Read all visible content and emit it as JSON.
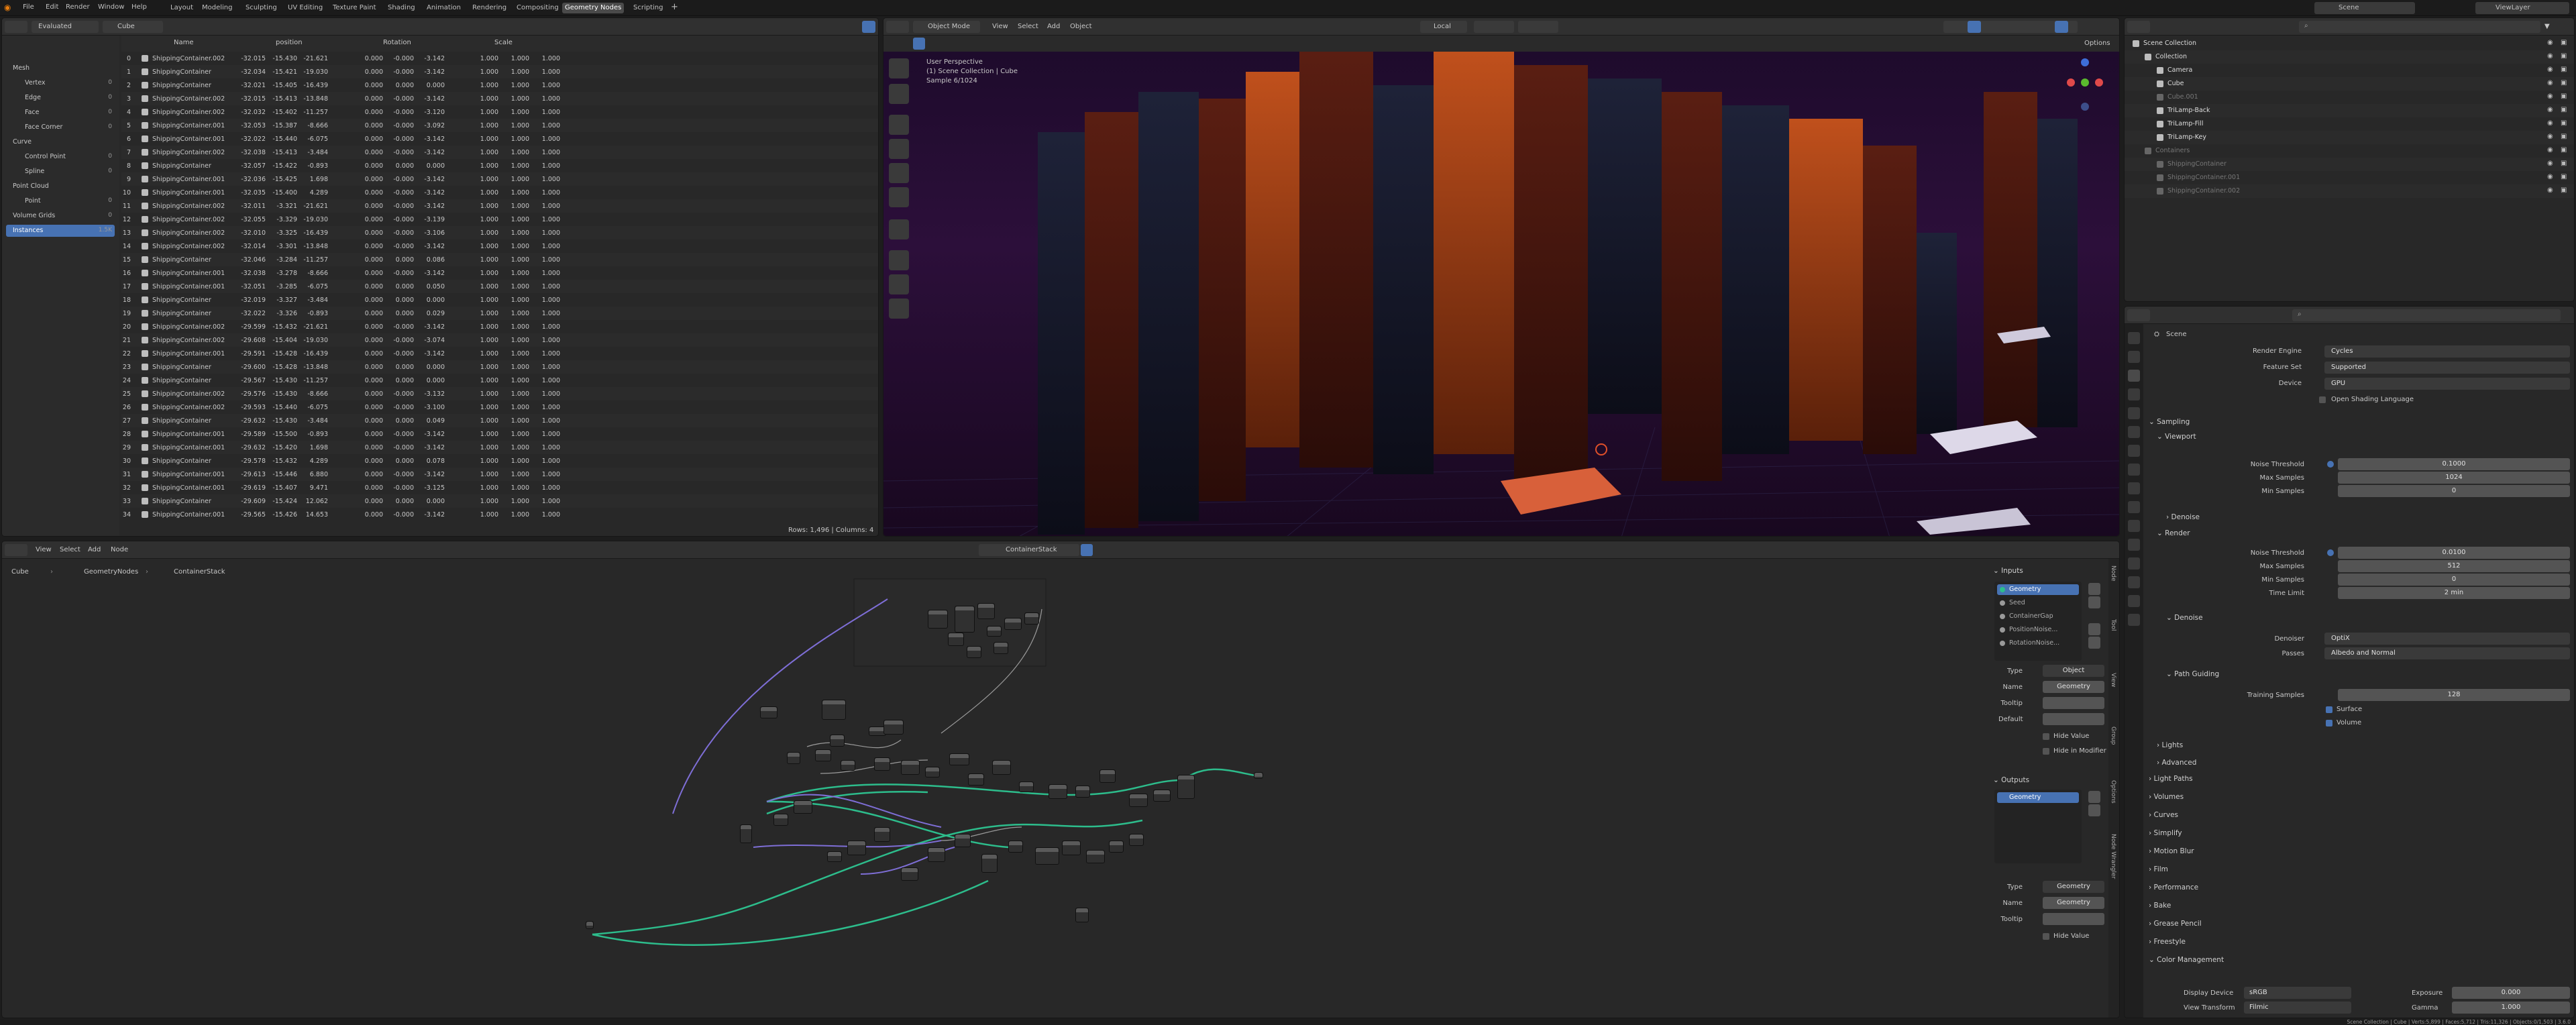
{
  "menu": {
    "file": "File",
    "edit": "Edit",
    "render": "Render",
    "window": "Window",
    "help": "Help"
  },
  "workspaces": [
    "Layout",
    "Modeling",
    "Sculpting",
    "UV Editing",
    "Texture Paint",
    "Shading",
    "Animation",
    "Rendering",
    "Compositing",
    "Geometry Nodes",
    "Scripting"
  ],
  "scene_name": "Scene",
  "view_layer": "ViewLayer",
  "spreadsheet": {
    "mode": "Evaluated",
    "object": "Cube",
    "domains": [
      {
        "label": "Mesh",
        "count": ""
      },
      {
        "label": "Vertex",
        "count": "0"
      },
      {
        "label": "Edge",
        "count": "0"
      },
      {
        "label": "Face",
        "count": "0"
      },
      {
        "label": "Face Corner",
        "count": "0"
      },
      {
        "label": "Curve",
        "count": ""
      },
      {
        "label": "Control Point",
        "count": "0"
      },
      {
        "label": "Spline",
        "count": "0"
      },
      {
        "label": "Point Cloud",
        "count": ""
      },
      {
        "label": "Point",
        "count": "0"
      },
      {
        "label": "Volume Grids",
        "count": "0"
      },
      {
        "label": "Instances",
        "count": "1.5K"
      }
    ],
    "columns": {
      "name": "Name",
      "position": "position",
      "rotation": "Rotation",
      "scale": "Scale"
    },
    "rows": [
      [
        "0",
        "ShippingContainer.002",
        "-32.015",
        "-15.430",
        "-21.621",
        "0.000",
        "-0.000",
        "-3.142",
        "1.000",
        "1.000",
        "1.000"
      ],
      [
        "1",
        "ShippingContainer",
        "-32.034",
        "-15.421",
        "-19.030",
        "0.000",
        "-0.000",
        "-3.142",
        "1.000",
        "1.000",
        "1.000"
      ],
      [
        "2",
        "ShippingContainer",
        "-32.021",
        "-15.405",
        "-16.439",
        "0.000",
        "0.000",
        "0.000",
        "1.000",
        "1.000",
        "1.000"
      ],
      [
        "3",
        "ShippingContainer.002",
        "-32.015",
        "-15.413",
        "-13.848",
        "0.000",
        "-0.000",
        "-3.142",
        "1.000",
        "1.000",
        "1.000"
      ],
      [
        "4",
        "ShippingContainer.002",
        "-32.032",
        "-15.402",
        "-11.257",
        "0.000",
        "-0.000",
        "-3.120",
        "1.000",
        "1.000",
        "1.000"
      ],
      [
        "5",
        "ShippingContainer.001",
        "-32.053",
        "-15.387",
        "-8.666",
        "0.000",
        "-0.000",
        "-3.092",
        "1.000",
        "1.000",
        "1.000"
      ],
      [
        "6",
        "ShippingContainer.001",
        "-32.022",
        "-15.440",
        "-6.075",
        "0.000",
        "-0.000",
        "-3.142",
        "1.000",
        "1.000",
        "1.000"
      ],
      [
        "7",
        "ShippingContainer.002",
        "-32.038",
        "-15.413",
        "-3.484",
        "0.000",
        "-0.000",
        "-3.142",
        "1.000",
        "1.000",
        "1.000"
      ],
      [
        "8",
        "ShippingContainer",
        "-32.057",
        "-15.422",
        "-0.893",
        "0.000",
        "0.000",
        "0.000",
        "1.000",
        "1.000",
        "1.000"
      ],
      [
        "9",
        "ShippingContainer.001",
        "-32.036",
        "-15.425",
        "1.698",
        "0.000",
        "-0.000",
        "-3.142",
        "1.000",
        "1.000",
        "1.000"
      ],
      [
        "10",
        "ShippingContainer.001",
        "-32.035",
        "-15.400",
        "4.289",
        "0.000",
        "-0.000",
        "-3.142",
        "1.000",
        "1.000",
        "1.000"
      ],
      [
        "11",
        "ShippingContainer.002",
        "-32.011",
        "-3.321",
        "-21.621",
        "0.000",
        "-0.000",
        "-3.142",
        "1.000",
        "1.000",
        "1.000"
      ],
      [
        "12",
        "ShippingContainer.002",
        "-32.055",
        "-3.329",
        "-19.030",
        "0.000",
        "-0.000",
        "-3.139",
        "1.000",
        "1.000",
        "1.000"
      ],
      [
        "13",
        "ShippingContainer.002",
        "-32.010",
        "-3.325",
        "-16.439",
        "0.000",
        "-0.000",
        "-3.106",
        "1.000",
        "1.000",
        "1.000"
      ],
      [
        "14",
        "ShippingContainer.002",
        "-32.014",
        "-3.301",
        "-13.848",
        "0.000",
        "-0.000",
        "-3.142",
        "1.000",
        "1.000",
        "1.000"
      ],
      [
        "15",
        "ShippingContainer",
        "-32.046",
        "-3.284",
        "-11.257",
        "0.000",
        "0.000",
        "0.086",
        "1.000",
        "1.000",
        "1.000"
      ],
      [
        "16",
        "ShippingContainer.001",
        "-32.038",
        "-3.278",
        "-8.666",
        "0.000",
        "-0.000",
        "-3.142",
        "1.000",
        "1.000",
        "1.000"
      ],
      [
        "17",
        "ShippingContainer.001",
        "-32.051",
        "-3.285",
        "-6.075",
        "0.000",
        "0.000",
        "0.050",
        "1.000",
        "1.000",
        "1.000"
      ],
      [
        "18",
        "ShippingContainer",
        "-32.019",
        "-3.327",
        "-3.484",
        "0.000",
        "0.000",
        "0.000",
        "1.000",
        "1.000",
        "1.000"
      ],
      [
        "19",
        "ShippingContainer",
        "-32.022",
        "-3.326",
        "-0.893",
        "0.000",
        "0.000",
        "0.029",
        "1.000",
        "1.000",
        "1.000"
      ],
      [
        "20",
        "ShippingContainer.002",
        "-29.599",
        "-15.432",
        "-21.621",
        "0.000",
        "-0.000",
        "-3.142",
        "1.000",
        "1.000",
        "1.000"
      ],
      [
        "21",
        "ShippingContainer.002",
        "-29.608",
        "-15.404",
        "-19.030",
        "0.000",
        "-0.000",
        "-3.074",
        "1.000",
        "1.000",
        "1.000"
      ],
      [
        "22",
        "ShippingContainer.001",
        "-29.591",
        "-15.428",
        "-16.439",
        "0.000",
        "-0.000",
        "-3.142",
        "1.000",
        "1.000",
        "1.000"
      ],
      [
        "23",
        "ShippingContainer",
        "-29.600",
        "-15.428",
        "-13.848",
        "0.000",
        "0.000",
        "0.000",
        "1.000",
        "1.000",
        "1.000"
      ],
      [
        "24",
        "ShippingContainer",
        "-29.567",
        "-15.430",
        "-11.257",
        "0.000",
        "0.000",
        "0.000",
        "1.000",
        "1.000",
        "1.000"
      ],
      [
        "25",
        "ShippingContainer.002",
        "-29.576",
        "-15.430",
        "-8.666",
        "0.000",
        "-0.000",
        "-3.132",
        "1.000",
        "1.000",
        "1.000"
      ],
      [
        "26",
        "ShippingContainer.002",
        "-29.593",
        "-15.440",
        "-6.075",
        "0.000",
        "-0.000",
        "-3.100",
        "1.000",
        "1.000",
        "1.000"
      ],
      [
        "27",
        "ShippingContainer",
        "-29.632",
        "-15.430",
        "-3.484",
        "0.000",
        "0.000",
        "0.049",
        "1.000",
        "1.000",
        "1.000"
      ],
      [
        "28",
        "ShippingContainer.001",
        "-29.589",
        "-15.500",
        "-0.893",
        "0.000",
        "-0.000",
        "-3.142",
        "1.000",
        "1.000",
        "1.000"
      ],
      [
        "29",
        "ShippingContainer.001",
        "-29.632",
        "-15.420",
        "1.698",
        "0.000",
        "-0.000",
        "-3.142",
        "1.000",
        "1.000",
        "1.000"
      ],
      [
        "30",
        "ShippingContainer",
        "-29.578",
        "-15.432",
        "4.289",
        "0.000",
        "0.000",
        "0.078",
        "1.000",
        "1.000",
        "1.000"
      ],
      [
        "31",
        "ShippingContainer.001",
        "-29.613",
        "-15.446",
        "6.880",
        "0.000",
        "-0.000",
        "-3.142",
        "1.000",
        "1.000",
        "1.000"
      ],
      [
        "32",
        "ShippingContainer.001",
        "-29.619",
        "-15.407",
        "9.471",
        "0.000",
        "-0.000",
        "-3.125",
        "1.000",
        "1.000",
        "1.000"
      ],
      [
        "33",
        "ShippingContainer",
        "-29.609",
        "-15.424",
        "12.062",
        "0.000",
        "0.000",
        "0.000",
        "1.000",
        "1.000",
        "1.000"
      ],
      [
        "34",
        "ShippingContainer.001",
        "-29.565",
        "-15.426",
        "14.653",
        "0.000",
        "-0.000",
        "-3.142",
        "1.000",
        "1.000",
        "1.000"
      ]
    ],
    "footer": "Rows: 1,496  |  Columns: 4"
  },
  "viewport": {
    "mode": "Object Mode",
    "menus": [
      "View",
      "Select",
      "Add",
      "Object"
    ],
    "orientation": "Local",
    "options": "Options",
    "info1": "User Perspective",
    "info2": "(1) Scene Collection | Cube",
    "info3": "Sample 6/1024"
  },
  "outliner": {
    "items": [
      {
        "label": "Scene Collection",
        "indent": 0
      },
      {
        "label": "Collection",
        "indent": 1
      },
      {
        "label": "Camera",
        "indent": 2
      },
      {
        "label": "Cube",
        "indent": 2
      },
      {
        "label": "Cube.001",
        "indent": 2,
        "dim": true
      },
      {
        "label": "TriLamp-Back",
        "indent": 2
      },
      {
        "label": "TriLamp-Fill",
        "indent": 2
      },
      {
        "label": "TriLamp-Key",
        "indent": 2
      },
      {
        "label": "Containers",
        "indent": 1,
        "dim": true
      },
      {
        "label": "ShippingContainer",
        "indent": 2,
        "dim": true
      },
      {
        "label": "ShippingContainer.001",
        "indent": 2,
        "dim": true
      },
      {
        "label": "ShippingContainer.002",
        "indent": 2,
        "dim": true
      }
    ]
  },
  "properties": {
    "scene": "Scene",
    "render_engine_label": "Render Engine",
    "render_engine": "Cycles",
    "feature_set_label": "Feature Set",
    "feature_set": "Supported",
    "device_label": "Device",
    "device": "GPU",
    "osl": "Open Shading Language",
    "sampling": "Sampling",
    "viewport": "Viewport",
    "noise_threshold_label": "Noise Threshold",
    "vp_noise": "0.1000",
    "max_samples_label": "Max Samples",
    "vp_max": "1024",
    "min_samples_label": "Min Samples",
    "vp_min": "0",
    "denoise": "Denoise",
    "render": "Render",
    "r_noise": "0.0100",
    "r_max": "512",
    "r_min": "0",
    "time_limit_label": "Time Limit",
    "time_limit": "2 min",
    "denoiser_label": "Denoiser",
    "denoiser": "OptiX",
    "passes_label": "Passes",
    "passes": "Albedo and Normal",
    "path_guiding": "Path Guiding",
    "training_label": "Training Samples",
    "training": "128",
    "surface": "Surface",
    "volume": "Volume",
    "lights": "Lights",
    "advanced": "Advanced",
    "sections": [
      "Light Paths",
      "Volumes",
      "Curves",
      "Simplify",
      "Motion Blur",
      "Film",
      "Performance",
      "Bake",
      "Grease Pencil",
      "Freestyle",
      "Color Management"
    ],
    "display_device_label": "Display Device",
    "display_device": "sRGB",
    "view_transform_label": "View Transform",
    "view_transform": "Filmic",
    "exposure_label": "Exposure",
    "exposure": "0.000",
    "gamma_label": "Gamma",
    "gamma": "1.000"
  },
  "node_editor": {
    "menus": [
      "View",
      "Select",
      "Add",
      "Node"
    ],
    "tree": "ContainerStack",
    "breadcrumb": [
      "Cube",
      "GeometryNodes",
      "ContainerStack"
    ],
    "inputs_title": "Inputs",
    "inputs": [
      "Geometry",
      "Seed",
      "ContainerGap",
      "PositionNoise...",
      "RotationNoise..."
    ],
    "type_label": "Type",
    "in_type": "Object",
    "name_label": "Name",
    "in_name": "Geometry",
    "tooltip_label": "Tooltip",
    "default_label": "Default",
    "hide_value": "Hide Value",
    "hide_in_modifier": "Hide in Modifier",
    "outputs_title": "Outputs",
    "outputs": [
      "Geometry"
    ],
    "out_type": "Geometry",
    "out_name": "Geometry",
    "side_tabs": [
      "Node",
      "Tool",
      "View",
      "Group",
      "Options",
      "Node Wrangler"
    ]
  },
  "status": "Scene Collection | Cube | Verts:5,899 | Faces:5,712 | Tris:11,326 | Objects:0/1,503 | 3.6.0",
  "colors": {
    "accent": "#4772b3",
    "noodle": "#2dbd8c",
    "geometry_link": "#7e6ed6"
  }
}
